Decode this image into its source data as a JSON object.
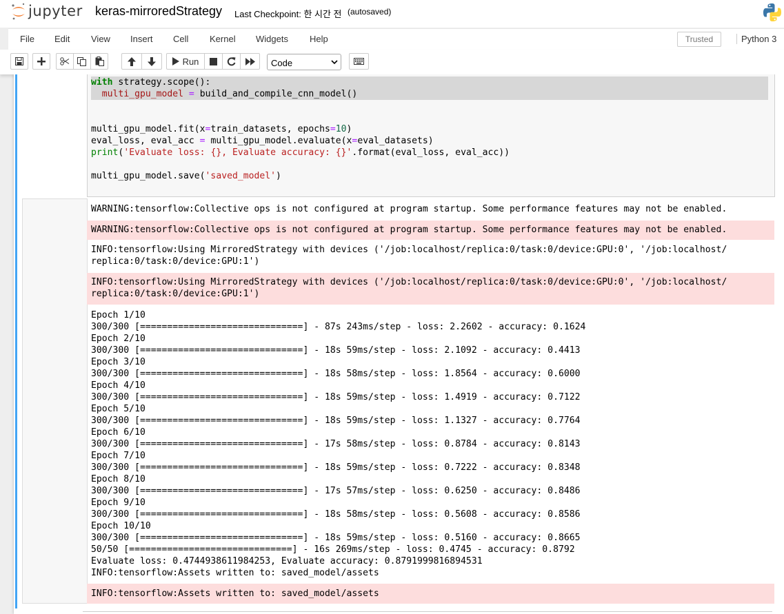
{
  "header": {
    "logo_text": "jupyter",
    "notebook_title": "keras-mirroredStrategy",
    "checkpoint": "Last Checkpoint: 한 시간 전",
    "autosave": "(autosaved)",
    "kernel_logo_icon": "python-logo-icon"
  },
  "menubar": {
    "items": [
      "File",
      "Edit",
      "View",
      "Insert",
      "Cell",
      "Kernel",
      "Widgets",
      "Help"
    ],
    "trusted_label": "Trusted",
    "kernel_label": "Python 3"
  },
  "toolbar": {
    "buttons": [
      "save-icon",
      "plus-icon",
      "cut-icon",
      "copy-icon",
      "paste-icon",
      "arrow-up-icon",
      "arrow-down-icon",
      "run-icon",
      "stop-icon",
      "restart-icon",
      "fast-forward-icon",
      "keyboard-icon"
    ],
    "run_label": "Run",
    "cell_type": "Code"
  },
  "code_cell": {
    "lines": [
      "with strategy.scope():",
      "  multi_gpu_model = build_and_compile_cnn_model()",
      "",
      "",
      "multi_gpu_model.fit(x=train_datasets, epochs=10)",
      "eval_loss, eval_acc = multi_gpu_model.evaluate(x=eval_datasets)",
      "print('Evaluate loss: {}, Evaluate accuracy: {}'.format(eval_loss, eval_acc))",
      "",
      "multi_gpu_model.save('saved_model')"
    ]
  },
  "outputs": [
    {
      "type": "stdout",
      "text": "WARNING:tensorflow:Collective ops is not configured at program startup. Some performance features may not be enabled."
    },
    {
      "type": "stderr",
      "text": "WARNING:tensorflow:Collective ops is not configured at program startup. Some performance features may not be enabled."
    },
    {
      "type": "stdout",
      "text": "INFO:tensorflow:Using MirroredStrategy with devices ('/job:localhost/replica:0/task:0/device:GPU:0', '/job:localhost/\nreplica:0/task:0/device:GPU:1')"
    },
    {
      "type": "stderr",
      "text": "INFO:tensorflow:Using MirroredStrategy with devices ('/job:localhost/replica:0/task:0/device:GPU:0', '/job:localhost/\nreplica:0/task:0/device:GPU:1')"
    },
    {
      "type": "stdout",
      "text": "Epoch 1/10\n300/300 [==============================] - 87s 243ms/step - loss: 2.2602 - accuracy: 0.1624\nEpoch 2/10\n300/300 [==============================] - 18s 59ms/step - loss: 2.1092 - accuracy: 0.4413\nEpoch 3/10\n300/300 [==============================] - 18s 58ms/step - loss: 1.8564 - accuracy: 0.6000\nEpoch 4/10\n300/300 [==============================] - 18s 59ms/step - loss: 1.4919 - accuracy: 0.7122\nEpoch 5/10\n300/300 [==============================] - 18s 59ms/step - loss: 1.1327 - accuracy: 0.7764\nEpoch 6/10\n300/300 [==============================] - 17s 58ms/step - loss: 0.8784 - accuracy: 0.8143\nEpoch 7/10\n300/300 [==============================] - 18s 59ms/step - loss: 0.7222 - accuracy: 0.8348\nEpoch 8/10\n300/300 [==============================] - 17s 57ms/step - loss: 0.6250 - accuracy: 0.8486\nEpoch 9/10\n300/300 [==============================] - 18s 58ms/step - loss: 0.5608 - accuracy: 0.8586\nEpoch 10/10\n300/300 [==============================] - 18s 59ms/step - loss: 0.5160 - accuracy: 0.8665\n50/50 [==============================] - 16s 269ms/step - loss: 0.4745 - accuracy: 0.8792\nEvaluate loss: 0.4744938611984253, Evaluate accuracy: 0.8791999816894531\nINFO:tensorflow:Assets written to: saved_model/assets"
    },
    {
      "type": "stderr",
      "text": "INFO:tensorflow:Assets written to: saved_model/assets"
    }
  ],
  "colors": {
    "stderr_background": "#fddddd",
    "selected_cell_bar": "#42a5f5",
    "keyword": "#008000",
    "string": "#ba2121",
    "number": "#116644",
    "operator": "#aa22ff"
  }
}
